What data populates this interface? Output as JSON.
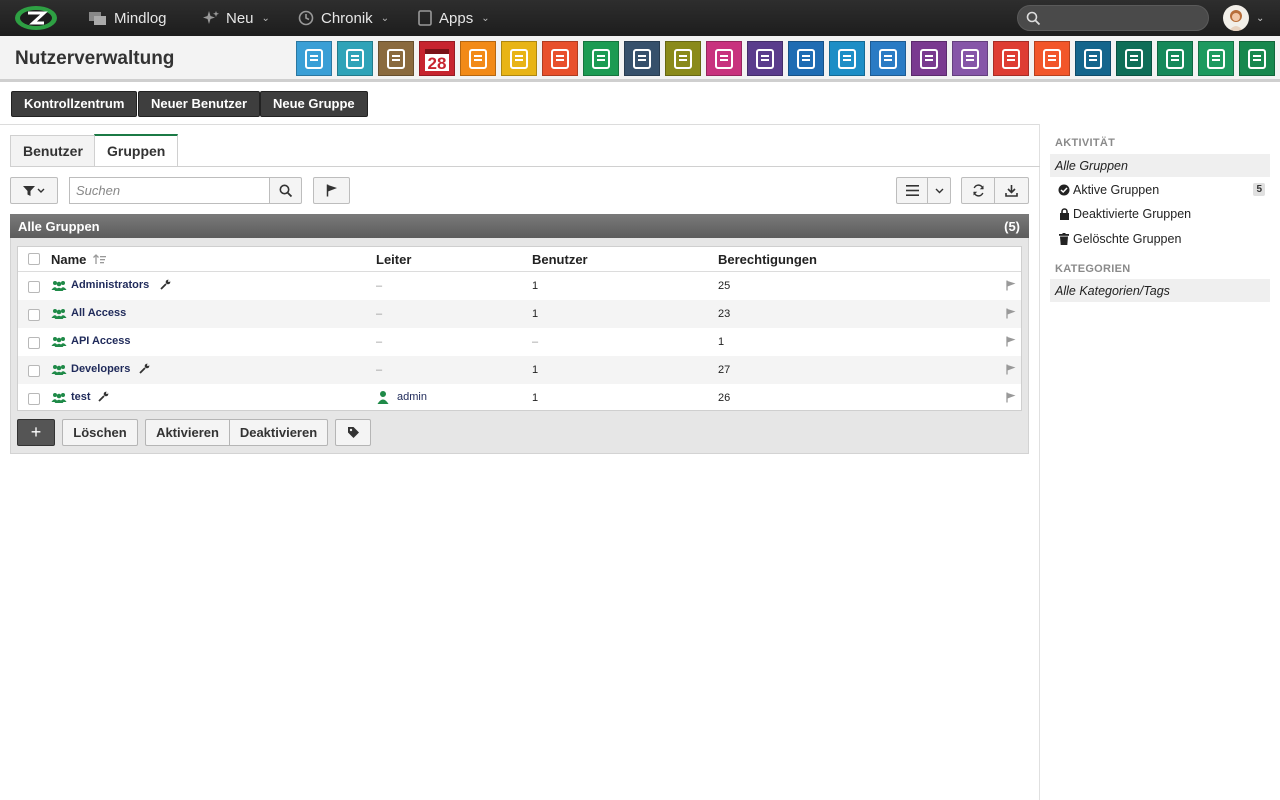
{
  "topbar": {
    "nav": [
      {
        "label": "Mindlog",
        "icon": "message-icon"
      },
      {
        "label": "Neu",
        "icon": "sparkle-icon",
        "has_caret": true
      },
      {
        "label": "Chronik",
        "icon": "history-icon",
        "has_caret": true
      },
      {
        "label": "Apps",
        "icon": "tablet-icon",
        "has_caret": true
      }
    ],
    "search_placeholder": ""
  },
  "header": {
    "title": "Nutzerverwaltung",
    "app_icons": [
      {
        "name": "mail-app-icon",
        "color": "#3a9fd6"
      },
      {
        "name": "contacts-email-app-icon",
        "color": "#2fa3b8"
      },
      {
        "name": "address-book-app-icon",
        "color": "#8a6a3e"
      },
      {
        "name": "calendar-app-icon",
        "color": "#c7242f",
        "label": "28"
      },
      {
        "name": "timer-app-icon",
        "color": "#f28a17"
      },
      {
        "name": "tasks-app-icon",
        "color": "#e8b416"
      },
      {
        "name": "projects-app-icon",
        "color": "#e8502c"
      },
      {
        "name": "notes-app-icon",
        "color": "#1c9b53"
      },
      {
        "name": "bookmarks-app-icon",
        "color": "#36506b"
      },
      {
        "name": "documents-app-icon",
        "color": "#8a8a1a"
      },
      {
        "name": "shop-app-icon",
        "color": "#c8327e"
      },
      {
        "name": "finance-app-icon",
        "color": "#5a3c8c"
      },
      {
        "name": "delivery-app-icon",
        "color": "#1f6cb3"
      },
      {
        "name": "support-app-icon",
        "color": "#1d8ec6"
      },
      {
        "name": "money-bag-app-icon",
        "color": "#2a7bc4"
      },
      {
        "name": "contracts-app-icon",
        "color": "#7a3a90"
      },
      {
        "name": "partners-app-icon",
        "color": "#8656a8"
      },
      {
        "name": "pdf-app-icon",
        "color": "#de3d33"
      },
      {
        "name": "broadcast-app-icon",
        "color": "#f2562a"
      },
      {
        "name": "download-app-icon",
        "color": "#14658c"
      },
      {
        "name": "cart-app-icon",
        "color": "#0f6e58"
      },
      {
        "name": "payments-app-icon",
        "color": "#16895a"
      },
      {
        "name": "pricing-app-icon",
        "color": "#1d9a5f"
      },
      {
        "name": "database-app-icon",
        "color": "#17884e"
      }
    ]
  },
  "actions": {
    "kontrollzentrum": "Kontrollzentrum",
    "neuer_benutzer": "Neuer Benutzer",
    "neue_gruppe": "Neue Gruppe"
  },
  "tabs": {
    "benutzer": "Benutzer",
    "gruppen": "Gruppen"
  },
  "toolbar": {
    "search_placeholder": "Suchen"
  },
  "panel": {
    "title": "Alle Gruppen",
    "count": "(5)",
    "columns": {
      "name": "Name",
      "leiter": "Leiter",
      "benutzer": "Benutzer",
      "berechtigungen": "Berechtigungen"
    },
    "rows": [
      {
        "name": "Administrators",
        "has_wrench": true,
        "leiter": "–",
        "benutzer": "1",
        "berechtigungen": "25"
      },
      {
        "name": "All Access",
        "has_wrench": false,
        "leiter": "–",
        "benutzer": "1",
        "berechtigungen": "23"
      },
      {
        "name": "API Access",
        "has_wrench": false,
        "leiter": "–",
        "benutzer": "–",
        "berechtigungen": "1"
      },
      {
        "name": "Developers",
        "has_wrench": true,
        "leiter": "–",
        "benutzer": "1",
        "berechtigungen": "27"
      },
      {
        "name": "test",
        "has_wrench": true,
        "leiter": "admin",
        "benutzer": "1",
        "berechtigungen": "26"
      }
    ]
  },
  "bottom": {
    "add": "+",
    "loeschen": "Löschen",
    "aktivieren": "Aktivieren",
    "deaktivieren": "Deaktivieren"
  },
  "sidebar": {
    "aktivitaet_title": "AKTIVITÄT",
    "items": [
      {
        "label": "Alle Gruppen",
        "selected": true
      },
      {
        "label": "Aktive Gruppen",
        "icon": "check-circle-icon",
        "badge": "5"
      },
      {
        "label": "Deaktivierte Gruppen",
        "icon": "lock-icon"
      },
      {
        "label": "Gelöschte Gruppen",
        "icon": "trash-icon"
      }
    ],
    "kategorien_title": "KATEGORIEN",
    "kategorien_item": "Alle Kategorien/Tags"
  },
  "colors": {
    "accent_green": "#1b7a45",
    "group_icon": "#1f8a48",
    "name_link": "#1f2a5a"
  }
}
